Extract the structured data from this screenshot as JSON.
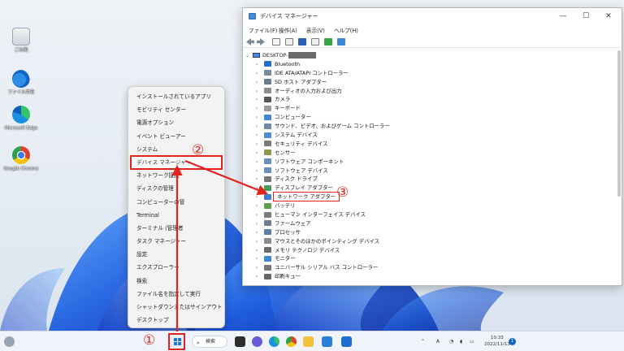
{
  "desktop": {
    "icons": [
      {
        "label": "ごみ箱",
        "icon": "recycle-bin-icon"
      },
      {
        "label": "ファイル共有",
        "icon": "onedrive-icon"
      },
      {
        "label": "Microsoft Edge",
        "icon": "edge-icon"
      },
      {
        "label": "Google Chrome",
        "icon": "chrome-icon"
      }
    ]
  },
  "winx_menu": {
    "items": [
      {
        "label": "インストールされているアプリ"
      },
      {
        "label": "モビリティ センター"
      },
      {
        "label": "電源オプション"
      },
      {
        "label": "イベント ビューアー"
      },
      {
        "label": "システム"
      },
      {
        "label": "デバイス マネージャー",
        "highlighted": true
      },
      {
        "label": "ネットワーク接続"
      },
      {
        "label": "ディスクの管理"
      },
      {
        "label": "コンピューターの管"
      },
      {
        "label": "Terminal"
      },
      {
        "label": "ターミナル (管理者"
      },
      {
        "label": "タスク マネージャー"
      },
      {
        "label": "設定"
      },
      {
        "label": "エクスプローラー"
      },
      {
        "label": "検索"
      },
      {
        "label": "ファイル名を指定して実行"
      },
      {
        "label": "シャットダウンまたはサインアウト",
        "submenu": true
      },
      {
        "label": "デスクトップ"
      }
    ]
  },
  "device_manager": {
    "title": "デバイス マネージャー",
    "window_controls": {
      "minimize": "—",
      "maximize": "☐",
      "close": "✕"
    },
    "menu": [
      "ファイル(F)",
      "操作(A)",
      "表示(V)",
      "ヘルプ(H)"
    ],
    "root": "DESKTOP-",
    "categories": [
      {
        "label": "Bluetooth",
        "color": "#1e6fd0"
      },
      {
        "label": "IDE ATA/ATAPI コントローラー",
        "color": "#7a8a9a"
      },
      {
        "label": "SD ホスト アダプター",
        "color": "#6c7c8c"
      },
      {
        "label": "オーディオの入力および出力",
        "color": "#8c8c8c"
      },
      {
        "label": "カメラ",
        "color": "#555555"
      },
      {
        "label": "キーボード",
        "color": "#9a9a9a"
      },
      {
        "label": "コンピューター",
        "color": "#3f86d6"
      },
      {
        "label": "サウンド、ビデオ、およびゲーム コントローラー",
        "color": "#6f8aa6"
      },
      {
        "label": "システム デバイス",
        "color": "#4d8fd6"
      },
      {
        "label": "セキュリティ デバイス",
        "color": "#7b7b7b"
      },
      {
        "label": "センサー",
        "color": "#8a9a4a"
      },
      {
        "label": "ソフトウェア コンポーネント",
        "color": "#6a8fb8"
      },
      {
        "label": "ソフトウェア デバイス",
        "color": "#6a8fb8"
      },
      {
        "label": "ディスク ドライブ",
        "color": "#777777"
      },
      {
        "label": "ディスプレイ アダプター",
        "color": "#4a9a5a"
      },
      {
        "label": "ネットワーク アダプター",
        "color": "#3c7fd0",
        "highlighted": true
      },
      {
        "label": "バッテリ",
        "color": "#5aa046"
      },
      {
        "label": "ヒューマン インターフェイス デバイス",
        "color": "#7c7c7c"
      },
      {
        "label": "ファームウェア",
        "color": "#6d7d8d"
      },
      {
        "label": "プロセッサ",
        "color": "#5a7da6"
      },
      {
        "label": "マウスとそのほかのポインティング デバイス",
        "color": "#8a8a8a"
      },
      {
        "label": "メモリ テクノロジ デバイス",
        "color": "#6a6a6a"
      },
      {
        "label": "モニター",
        "color": "#3f86d6"
      },
      {
        "label": "ユニバーサル シリアル バス コントローラー",
        "color": "#777777"
      },
      {
        "label": "印刷キュー",
        "color": "#666666"
      }
    ]
  },
  "taskbar": {
    "search_label": "検索",
    "clock_time": "10:33",
    "clock_date": "2022/11/13",
    "notification_count": "1",
    "tray_language": "A"
  },
  "annotations": {
    "step1": "①",
    "step2": "②",
    "step3": "③",
    "color": "#e0231c"
  }
}
